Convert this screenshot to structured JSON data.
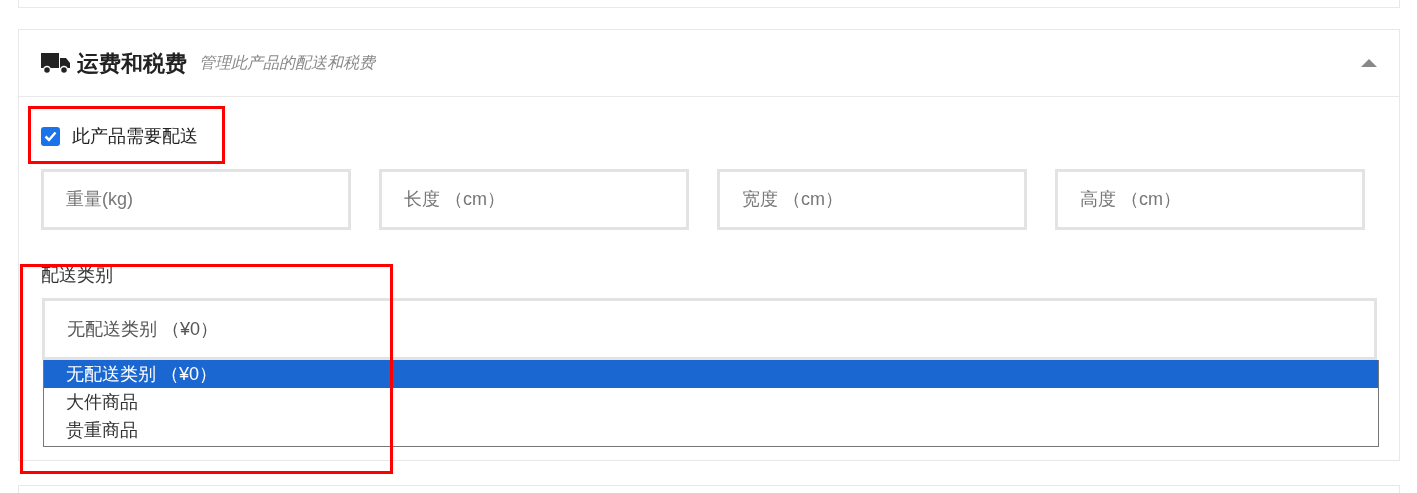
{
  "section": {
    "title": "运费和税费",
    "subtitle": "管理此产品的配送和税费",
    "expanded": true
  },
  "requires_shipping": {
    "label": "此产品需要配送",
    "checked": true
  },
  "dimension_fields": [
    {
      "placeholder": "重量(kg)"
    },
    {
      "placeholder": "长度 （cm）"
    },
    {
      "placeholder": "宽度 （cm）"
    },
    {
      "placeholder": "高度 （cm）"
    }
  ],
  "shipping_class": {
    "label": "配送类别",
    "value": "无配送类别 （¥0）",
    "options": [
      {
        "label": "无配送类别 （¥0）",
        "selected": true
      },
      {
        "label": "大件商品",
        "selected": false
      },
      {
        "label": "贵重商品",
        "selected": false
      }
    ]
  }
}
